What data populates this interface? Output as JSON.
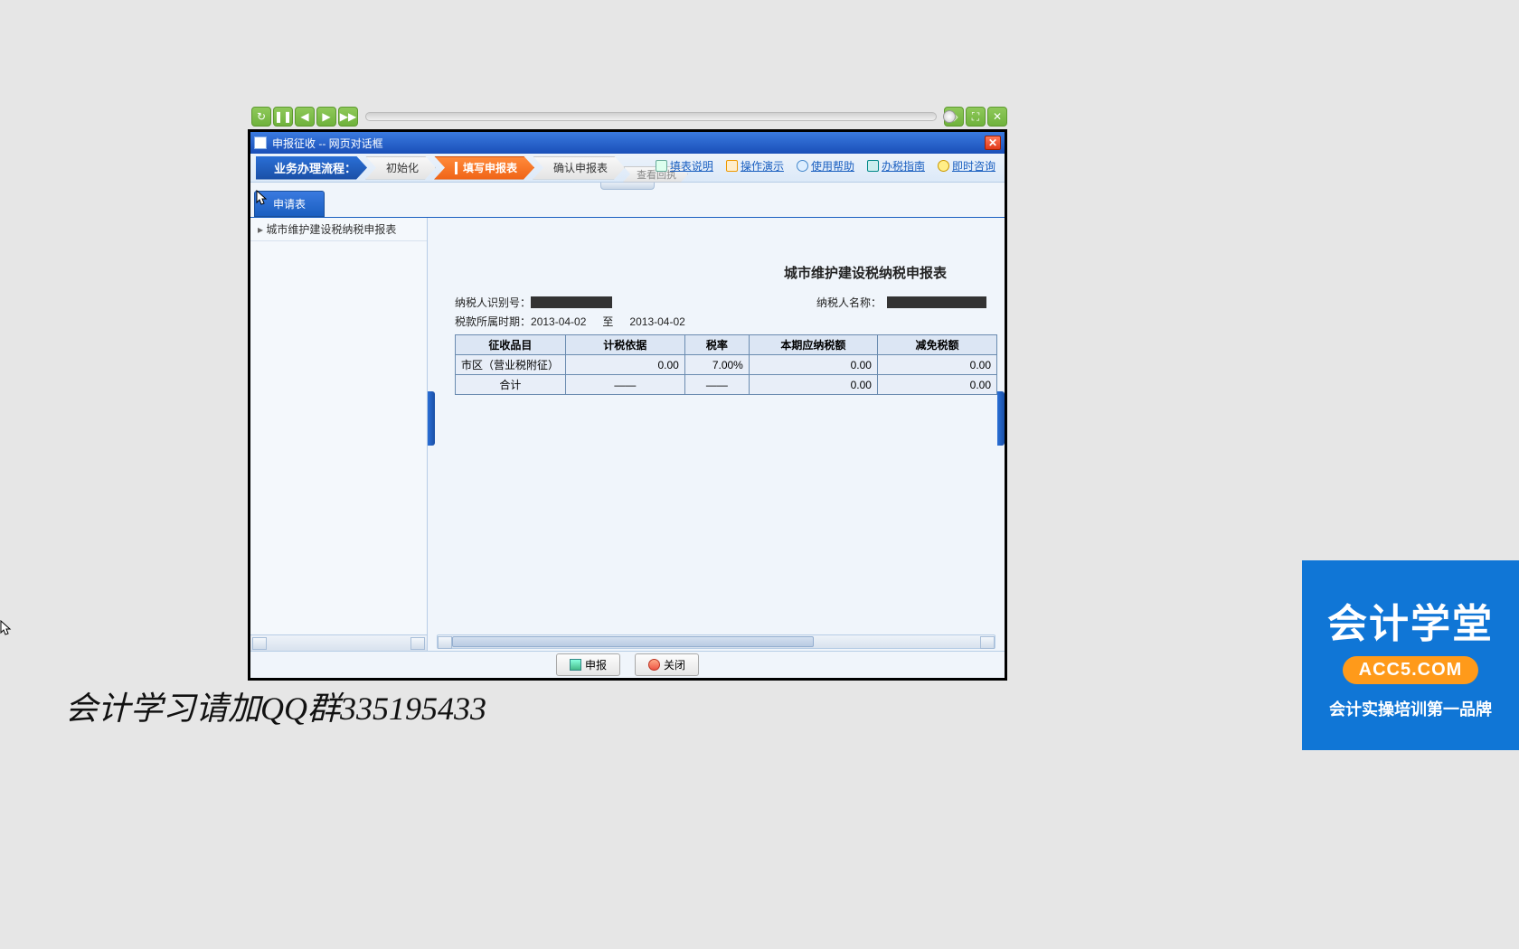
{
  "window": {
    "title": "申报征收  --  网页对话框"
  },
  "flow": {
    "label": "业务办理流程：",
    "steps": [
      "初始化",
      "填写申报表",
      "确认申报表"
    ],
    "substep": "查看回执",
    "active_index": 1
  },
  "help_links": [
    "填表说明",
    "操作演示",
    "使用帮助",
    "办税指南",
    "即时咨询"
  ],
  "tab": "申请表",
  "side_item": "城市维护建设税纳税申报表",
  "form": {
    "title": "城市维护建设税纳税申报表",
    "taxpayer_id_label": "纳税人识别号：",
    "taxpayer_name_label": "纳税人名称：",
    "period_label": "税款所属时期：",
    "period_from": "2013-04-02",
    "period_to_word": "至",
    "period_to": "2013-04-02",
    "headers": [
      "征收品目",
      "计税依据",
      "税率",
      "本期应纳税额",
      "减免税额"
    ],
    "row1": {
      "item": "市区（营业税附征）",
      "basis": "0.00",
      "rate": "7.00%",
      "due": "0.00",
      "relief": "0.00"
    },
    "total": {
      "label": "合计",
      "basis": "——",
      "rate": "——",
      "due": "0.00",
      "relief": "0.00"
    }
  },
  "footer": {
    "submit": "申报",
    "close": "关闭"
  },
  "overlay": "会计学习请加QQ群335195433",
  "brand": {
    "main": "会计学堂",
    "pill": "ACC5.COM",
    "sub": "会计实操培训第一品牌"
  }
}
